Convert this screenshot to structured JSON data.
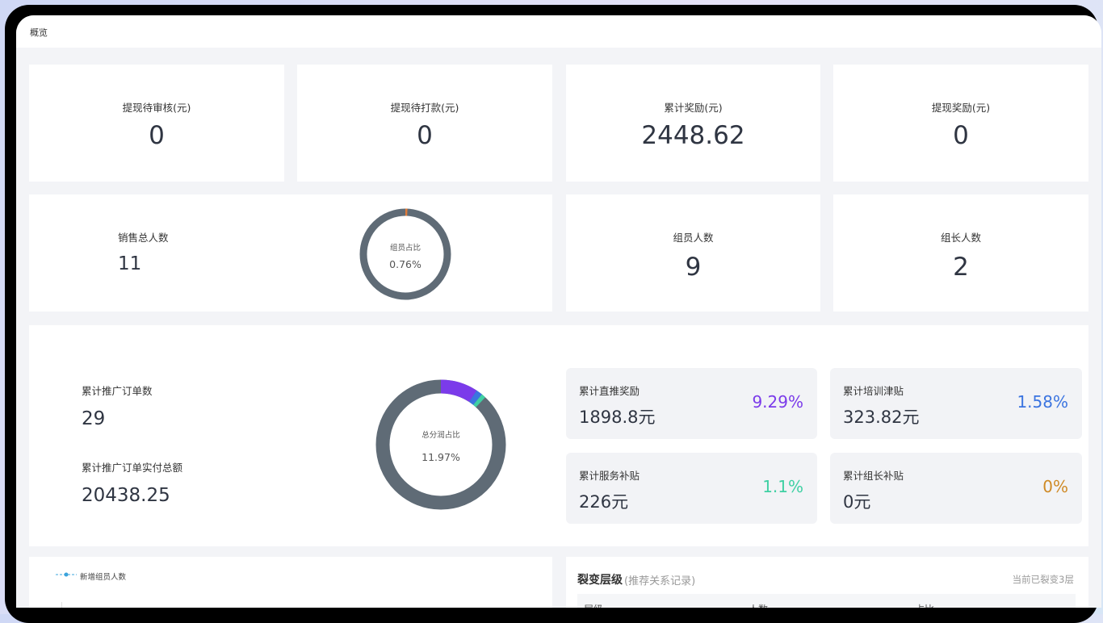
{
  "breadcrumb": "概览",
  "stats_row1": [
    {
      "title": "提现待审核(元)",
      "value": "0"
    },
    {
      "title": "提现待打款(元)",
      "value": "0"
    },
    {
      "title": "累计奖励(元)",
      "value": "2448.62"
    },
    {
      "title": "提现奖励(元)",
      "value": "0"
    }
  ],
  "sales": {
    "title": "销售总人数",
    "value": "11",
    "ring_label": "组员占比",
    "ring_value": "0.76%"
  },
  "members": {
    "title": "组员人数",
    "value": "9"
  },
  "leaders": {
    "title": "组长人数",
    "value": "2"
  },
  "promo": {
    "orders_title": "累计推广订单数",
    "orders_value": "29",
    "amount_title": "累计推广订单实付总额",
    "amount_value": "20438.25",
    "ring_label": "总分润占比",
    "ring_value": "11.97%"
  },
  "minis": [
    {
      "title": "累计直推奖励",
      "value": "1898.8元",
      "pct": "9.29%",
      "color": "#7b3bea"
    },
    {
      "title": "累计培训津贴",
      "value": "323.82元",
      "pct": "1.58%",
      "color": "#3b74e0"
    },
    {
      "title": "累计服务补贴",
      "value": "226元",
      "pct": "1.1%",
      "color": "#3fd0a3"
    },
    {
      "title": "累计组长补贴",
      "value": "0元",
      "pct": "0%",
      "color": "#cf8a26"
    }
  ],
  "chart_data": {
    "type": "line",
    "series": [
      {
        "name": "新增组员人数",
        "values": []
      }
    ]
  },
  "fission": {
    "title": "裂变层级",
    "subtitle": "(推荐关系记录)",
    "status": "当前已裂变3层",
    "columns": [
      "层级",
      "人数",
      "占比"
    ]
  },
  "colors": {
    "ring_base": "#5f6b76",
    "accent_orange": "#e07b39",
    "accent_purple": "#7b3bea",
    "accent_blue": "#3b74e0",
    "accent_green": "#3fd0a3"
  }
}
